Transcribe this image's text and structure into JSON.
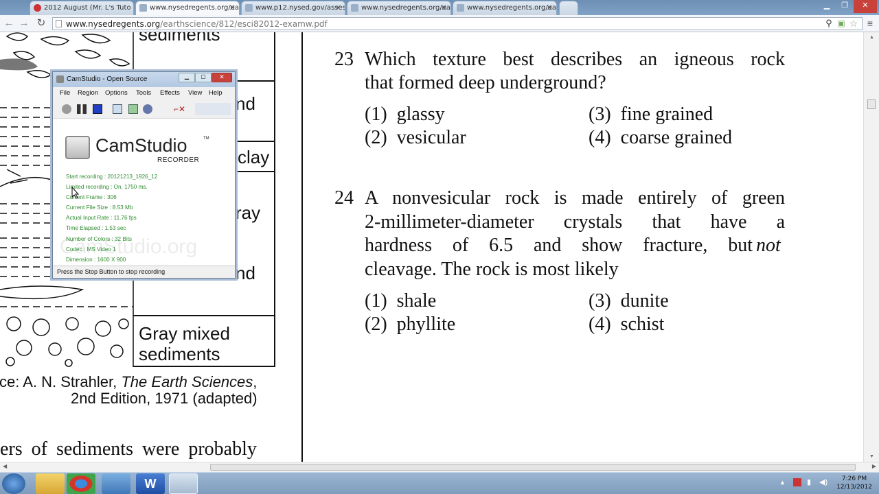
{
  "browser": {
    "tabs": [
      {
        "title": "2012 August (Mr. L's Tuto"
      },
      {
        "title": "www.nysedregents.org/ea"
      },
      {
        "title": "www.p12.nysed.gov/asses"
      },
      {
        "title": "www.nysedregents.org/ea"
      },
      {
        "title": "www.nysedregents.org/ea"
      }
    ],
    "url_host": "www.nysedregents.org",
    "url_path": "/earthscience/812/esci82012-examw.pdf"
  },
  "pdf": {
    "left_column": {
      "cells": [
        "sediments",
        "nd",
        "clay",
        "ray",
        "nd",
        "Gray mixed",
        "sediments"
      ],
      "source_prefix": "ce: A. N. Strahler, ",
      "source_title": "The Earth Sciences",
      "source_suffix": ",",
      "source_line2": "2nd Edition, 1971 (adapted)",
      "bottom_text": "ers of sediments were probably"
    },
    "questions": [
      {
        "number": "23",
        "lines": [
          "Which texture best describes an igneous rock",
          "that formed deep underground?"
        ],
        "options": [
          {
            "num": "(1)",
            "text": "glassy"
          },
          {
            "num": "(3)",
            "text": "fine grained"
          },
          {
            "num": "(2)",
            "text": "vesicular"
          },
          {
            "num": "(4)",
            "text": "coarse grained"
          }
        ]
      },
      {
        "number": "24",
        "lines": [
          "A nonvesicular rock is made entirely of green",
          "2-millimeter-diameter crystals that have a",
          "hardness of 6.5 and show fracture, but",
          "cleavage. The rock is most likely"
        ],
        "emphasis": "not",
        "options": [
          {
            "num": "(1)",
            "text": "shale"
          },
          {
            "num": "(3)",
            "text": "dunite"
          },
          {
            "num": "(2)",
            "text": "phyllite"
          },
          {
            "num": "(4)",
            "text": "schist"
          }
        ]
      }
    ]
  },
  "camstudio": {
    "title": "CamStudio - Open Source",
    "menu": [
      "File",
      "Region",
      "Options",
      "Tools",
      "Effects",
      "View",
      "Help"
    ],
    "logo_text": "CamStudio",
    "logo_tm": "TM",
    "logo_sub": "RECORDER",
    "watermark": "CamStudio.org",
    "stats": [
      "Start recording : 20121213_1926_12",
      "Limited recording : On, 1750 ms.",
      "Current Frame : 306",
      "Current File Size : 8.53 Mb",
      "Actual Input Rate : 11.76 fps",
      "Time Elapsed : 1.53 sec",
      "Number of Colors : 32 Bits",
      "Codec : MS Video 1",
      "Dimension : 1600 X 900"
    ],
    "status": "Press the Stop Button to stop recording"
  },
  "taskbar": {
    "time": "7:26 PM",
    "date": "12/13/2012"
  },
  "colors": {
    "stat_green": "#2e8b2e",
    "taskbar": "#8fabc9"
  }
}
